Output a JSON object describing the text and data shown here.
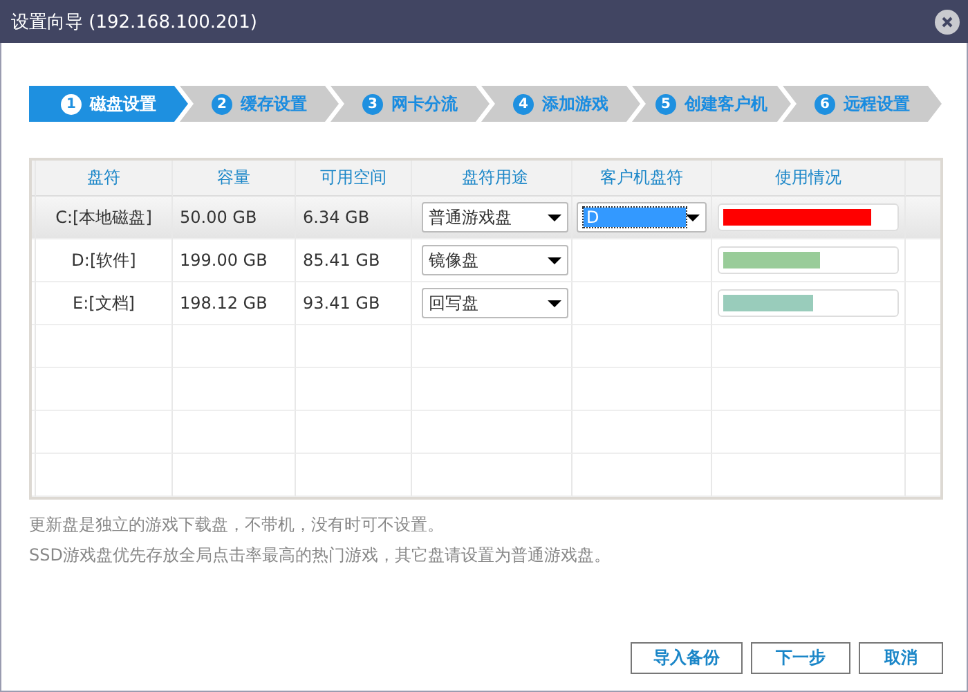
{
  "window": {
    "title": "设置向导 (192.168.100.201)"
  },
  "steps": [
    {
      "number": "1",
      "label": "磁盘设置",
      "selected": true
    },
    {
      "number": "2",
      "label": "缓存设置",
      "selected": false
    },
    {
      "number": "3",
      "label": "网卡分流",
      "selected": false
    },
    {
      "number": "4",
      "label": "添加游戏",
      "selected": false
    },
    {
      "number": "5",
      "label": "创建客户机",
      "selected": false
    },
    {
      "number": "6",
      "label": "远程设置",
      "selected": false
    }
  ],
  "table": {
    "columns": [
      "盘符",
      "容量",
      "可用空间",
      "盘符用途",
      "客户机盘符",
      "使用情况"
    ],
    "rows": [
      {
        "drive": "C:[本地磁盘]",
        "capacity": "50.00 GB",
        "free": "6.34 GB",
        "usage_type": "普通游戏盘",
        "client_drive": "D",
        "level": 0.87,
        "color": "#ff0000",
        "selected": true
      },
      {
        "drive": "D:[软件]",
        "capacity": "199.00 GB",
        "free": "85.41 GB",
        "usage_type": "镜像盘",
        "level": 0.57,
        "color": "#99cc99",
        "selected": false
      },
      {
        "drive": "E:[文档]",
        "capacity": "198.12 GB",
        "free": "93.41 GB",
        "usage_type": "回写盘",
        "level": 0.53,
        "color": "#99ccbb",
        "selected": false
      }
    ]
  },
  "notes": [
    "更新盘是独立的游戏下载盘，不带机，没有时可不设置。",
    "SSD游戏盘优先存放全局点击率最高的热门游戏，其它盘请设置为普通游戏盘。"
  ],
  "buttons": [
    "导入备份",
    "下一步",
    "取消"
  ]
}
